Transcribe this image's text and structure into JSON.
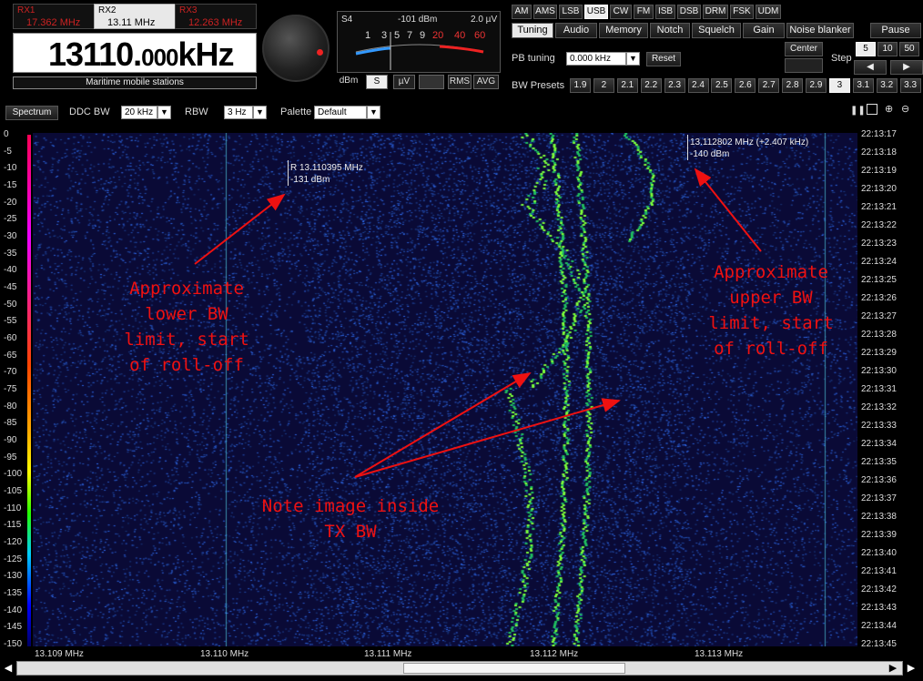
{
  "receivers": [
    {
      "name": "RX1",
      "freq": "17.362 MHz"
    },
    {
      "name": "RX2",
      "freq": "13.11 MHz"
    },
    {
      "name": "RX3",
      "freq": "12.263 MHz"
    }
  ],
  "frequency": {
    "main": "13110.",
    "fraction": "000",
    "unit": "kHz"
  },
  "band_label": "Maritime mobile stations",
  "smeter": {
    "channel": "S4",
    "dbm": "-101 dBm",
    "uv": "2.0 µV",
    "scale": [
      "1",
      "3",
      "5",
      "7",
      "9",
      "20",
      "40",
      "60"
    ],
    "unit_dbm": "dBm",
    "btn_s": "S",
    "btn_uv": "µV",
    "btn_rms": "RMS",
    "btn_avg": "AVG"
  },
  "modes": [
    "AM",
    "AMS",
    "LSB",
    "USB",
    "CW",
    "FM",
    "ISB",
    "DSB",
    "DRM",
    "FSK",
    "UDM"
  ],
  "active_mode": "USB",
  "tabs": [
    "Tuning",
    "Audio",
    "Memory",
    "Notch",
    "Squelch",
    "Gain",
    "Noise blanker",
    "Pause"
  ],
  "tuning": {
    "pb_label": "PB tuning",
    "pb_value": "0.000 kHz",
    "reset": "Reset",
    "center": "Center",
    "step_label": "Step",
    "steps": [
      "5",
      "10",
      "50"
    ],
    "bw_label": "BW Presets",
    "bw_presets": [
      "1.9",
      "2",
      "2.1",
      "2.2",
      "2.3",
      "2.4",
      "2.5",
      "2.6",
      "2.7",
      "2.8",
      "2.9",
      "3",
      "3.1",
      "3.2",
      "3.3"
    ],
    "active_bw": "3"
  },
  "toolbar": {
    "spectrum": "Spectrum",
    "ddc_label": "DDC BW",
    "ddc_value": "20 kHz",
    "rbw_label": "RBW",
    "rbw_value": "3 Hz",
    "palette_label": "Palette",
    "palette_value": "Default"
  },
  "y_axis": [
    "0",
    "-5",
    "-10",
    "-15",
    "-20",
    "-25",
    "-30",
    "-35",
    "-40",
    "-45",
    "-50",
    "-55",
    "-60",
    "-65",
    "-70",
    "-75",
    "-80",
    "-85",
    "-90",
    "-95",
    "-100",
    "-105",
    "-110",
    "-115",
    "-120",
    "-125",
    "-130",
    "-135",
    "-140",
    "-145",
    "-150"
  ],
  "time_axis": [
    "22:13:17",
    "22:13:18",
    "22:13:19",
    "22:13:20",
    "22:13:21",
    "22:13:22",
    "22:13:23",
    "22:13:24",
    "22:13:25",
    "22:13:26",
    "22:13:27",
    "22:13:28",
    "22:13:29",
    "22:13:30",
    "22:13:31",
    "22:13:32",
    "22:13:33",
    "22:13:34",
    "22:13:35",
    "22:13:36",
    "22:13:37",
    "22:13:38",
    "22:13:39",
    "22:13:40",
    "22:13:41",
    "22:13:42",
    "22:13:43",
    "22:13:44",
    "22:13:45"
  ],
  "x_axis": [
    "13.109 MHz",
    "13.110 MHz",
    "13.111 MHz",
    "13.112 MHz",
    "13.113 MHz"
  ],
  "markers": {
    "lower_freq": "R 13.110395 MHz",
    "lower_level": "-131 dBm",
    "upper_freq": "13.112802 MHz (+2.407 kHz)",
    "upper_level": "-140 dBm"
  },
  "annotations": {
    "lower": "Approximate\nlower BW\nlimit, start\nof roll-off",
    "upper": "Approximate\nupper BW\nlimit, start\nof roll-off",
    "image": "Note image inside\nTX BW"
  },
  "colors": {
    "annotation": "#e11111",
    "waterfall_bg": "#0a0a36",
    "signal": "#7cff3a"
  }
}
